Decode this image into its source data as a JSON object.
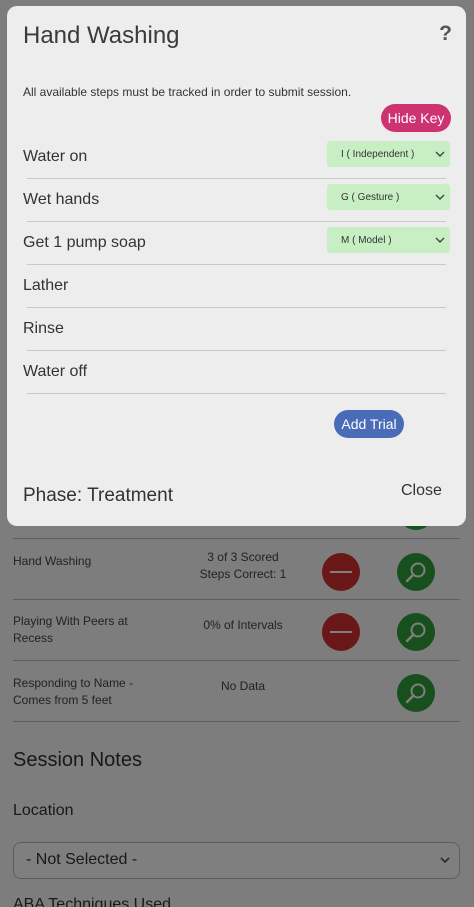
{
  "modal": {
    "title": "Hand Washing",
    "help_icon": "?",
    "notice": "All available steps must be tracked in order to submit session.",
    "hide_key_label": "Hide Key",
    "steps": [
      {
        "label": "Water on",
        "prompt": "I ( Independent )"
      },
      {
        "label": "Wet hands",
        "prompt": "G ( Gesture )"
      },
      {
        "label": "Get 1 pump soap",
        "prompt": "M ( Model )"
      },
      {
        "label": "Lather",
        "prompt": null
      },
      {
        "label": "Rinse",
        "prompt": null
      },
      {
        "label": "Water off",
        "prompt": null
      }
    ],
    "add_trial_label": "Add Trial",
    "phase": "Phase: Treatment",
    "close_label": "Close"
  },
  "programs": [
    {
      "name_lines": [
        "Hand Washing"
      ],
      "status_lines": [
        "3 of 3 Scored",
        "Steps Correct: 1"
      ],
      "has_delete": true,
      "has_view": true
    },
    {
      "name_lines": [
        "Playing With Peers at",
        "Recess"
      ],
      "status_lines": [
        "0% of Intervals"
      ],
      "has_delete": true,
      "has_view": true
    },
    {
      "name_lines": [
        "Responding to Name -",
        "Comes from 5 feet"
      ],
      "status_lines": [
        "No Data"
      ],
      "has_delete": false,
      "has_view": true
    }
  ],
  "session_notes": {
    "heading": "Session Notes",
    "location_label": "Location",
    "location_value": "- Not Selected -",
    "next_section_label": "ABA Techniques Used"
  },
  "icons": {
    "delete": "minus-icon",
    "view": "search-icon",
    "dropdown": "chevron-down-icon",
    "help": "question-icon"
  },
  "colors": {
    "hide_key": "#cc3370",
    "add_trial": "#4a6bb7",
    "prompt_bg": "#c8efc4",
    "delete_btn": "#d32f2f",
    "view_btn": "#2e9e3b"
  }
}
